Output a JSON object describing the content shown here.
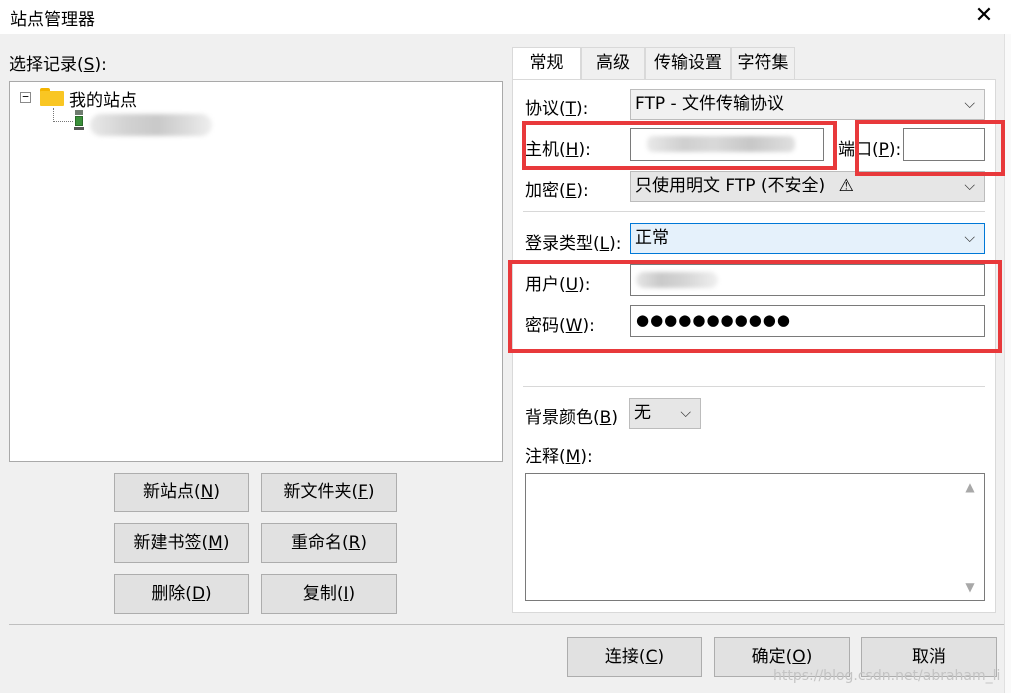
{
  "window": {
    "title": "站点管理器",
    "close_glyph": "✕"
  },
  "left": {
    "select_label_prefix": "选择记录(",
    "select_label_key": "S",
    "select_label_suffix": "):",
    "tree": {
      "root_toggle": "−",
      "root_label": "我的站点"
    },
    "buttons": [
      {
        "pre": "新站点(",
        "key": "N",
        "post": ")"
      },
      {
        "pre": "新文件夹(",
        "key": "F",
        "post": ")"
      },
      {
        "pre": "新建书签(",
        "key": "M",
        "post": ")"
      },
      {
        "pre": "重命名(",
        "key": "R",
        "post": ")"
      },
      {
        "pre": "删除(",
        "key": "D",
        "post": ")"
      },
      {
        "pre": "复制(",
        "key": "I",
        "post": ")"
      }
    ]
  },
  "tabs": [
    "常规",
    "高级",
    "传输设置",
    "字符集"
  ],
  "general": {
    "protocol": {
      "pre": "协议(",
      "key": "T",
      "post": "):",
      "value": "FTP - 文件传输协议"
    },
    "host": {
      "pre": "主机(",
      "key": "H",
      "post": "):",
      "value": ""
    },
    "port": {
      "pre": "端口(",
      "key": "P",
      "post": "):",
      "value": ""
    },
    "encryption": {
      "pre": "加密(",
      "key": "E",
      "post": "):",
      "value": "只使用明文 FTP (不安全)",
      "warning_glyph": "⚠"
    },
    "logon_type": {
      "pre": "登录类型(",
      "key": "L",
      "post": "):",
      "value": "正常"
    },
    "user": {
      "pre": "用户(",
      "key": "U",
      "post": "):",
      "value": ""
    },
    "password": {
      "pre": "密码(",
      "key": "W",
      "post": "):",
      "value": "●●●●●●●●●●●"
    },
    "bg_color": {
      "label": "背景颜色(",
      "key": "B",
      "post": ")",
      "value": "无"
    },
    "comments": {
      "pre": "注释(",
      "key": "M",
      "post": "):"
    }
  },
  "footer": {
    "connect": {
      "pre": "连接(",
      "key": "C",
      "post": ")"
    },
    "ok": {
      "pre": "确定(",
      "key": "O",
      "post": ")"
    },
    "cancel": "取消",
    "watermark": "https://blog.csdn.net/abraham_li"
  },
  "colors": {
    "highlight": "#e8393b",
    "logon_combo_bg": "#e5f1fb",
    "logon_combo_border": "#0078d7"
  },
  "icons": {
    "dropdown": "chevron-down-icon",
    "warning": "warning-icon",
    "folder": "folder-icon",
    "server": "server-icon"
  }
}
